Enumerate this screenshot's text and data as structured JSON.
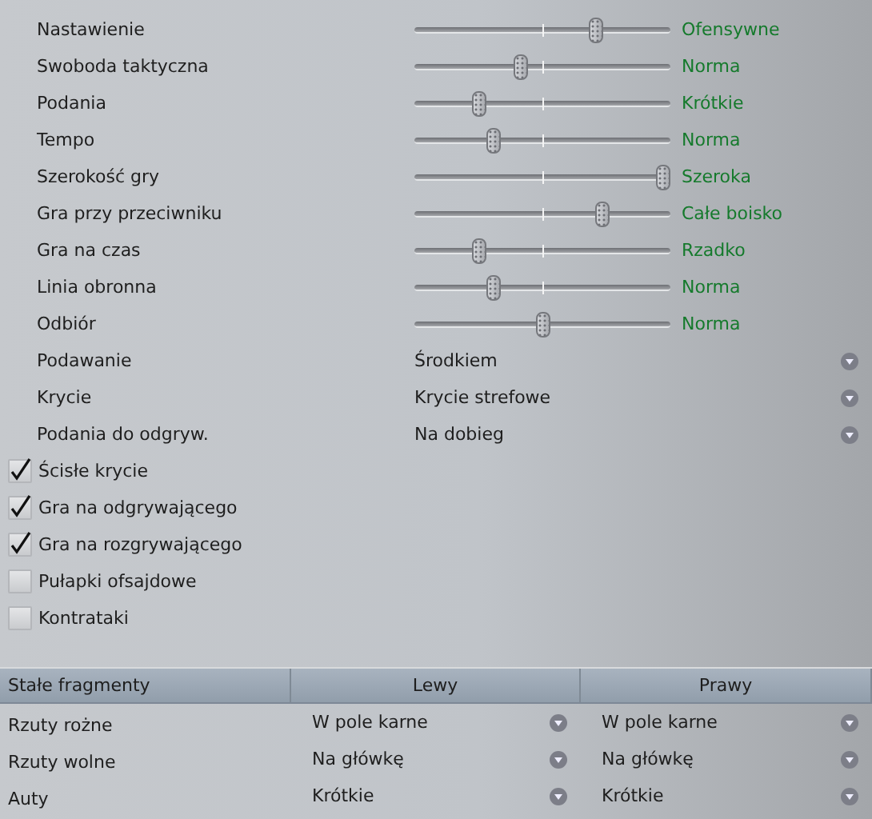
{
  "sliders": [
    {
      "label": "Nastawienie",
      "value": "Ofensywne",
      "level": 0.725
    },
    {
      "label": "Swoboda taktyczna",
      "value": "Norma",
      "level": 0.41
    },
    {
      "label": "Podania",
      "value": "Krótkie",
      "level": 0.24
    },
    {
      "label": "Tempo",
      "value": "Norma",
      "level": 0.3
    },
    {
      "label": "Szerokość gry",
      "value": "Szeroka",
      "level": 1.0
    },
    {
      "label": "Gra przy przeciwniku",
      "value": "Całe boisko",
      "level": 0.75
    },
    {
      "label": "Gra na czas",
      "value": "Rzadko",
      "level": 0.24
    },
    {
      "label": "Linia obronna",
      "value": "Norma",
      "level": 0.3
    },
    {
      "label": "Odbiór",
      "value": "Norma",
      "level": 0.5
    }
  ],
  "dropdowns": [
    {
      "label": "Podawanie",
      "value": "Środkiem"
    },
    {
      "label": "Krycie",
      "value": "Krycie strefowe"
    },
    {
      "label": "Podania do odgryw.",
      "value": "Na dobieg"
    }
  ],
  "checkboxes": [
    {
      "label": "Ścisłe krycie",
      "checked": true
    },
    {
      "label": "Gra na odgrywającego",
      "checked": true
    },
    {
      "label": "Gra na rozgrywającego",
      "checked": true
    },
    {
      "label": "Pułapki ofsajdowe",
      "checked": false
    },
    {
      "label": "Kontrataki",
      "checked": false
    }
  ],
  "set_pieces": {
    "columns": [
      "Stałe fragmenty",
      "Lewy",
      "Prawy"
    ],
    "rows": [
      {
        "label": "Rzuty rożne",
        "left": "W pole karne",
        "right": "W pole karne"
      },
      {
        "label": "Rzuty wolne",
        "left": "Na główkę",
        "right": "Na główkę"
      },
      {
        "label": "Auty",
        "left": "Krótkie",
        "right": "Krótkie"
      }
    ]
  }
}
